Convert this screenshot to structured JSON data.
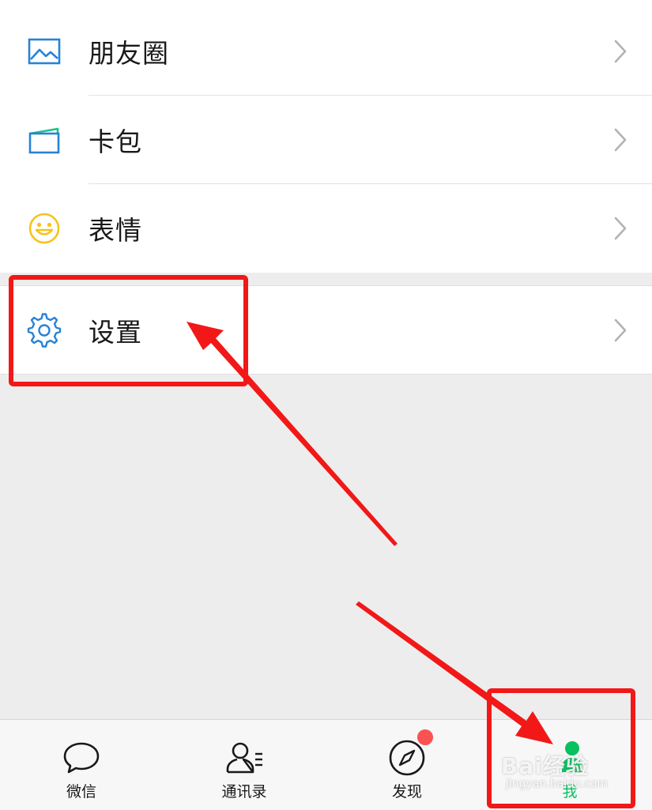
{
  "menu_group_1": [
    {
      "label": "朋友圈",
      "icon": "moments-image-icon"
    },
    {
      "label": "卡包",
      "icon": "card-wallet-icon"
    },
    {
      "label": "表情",
      "icon": "smiley-face-icon"
    }
  ],
  "menu_group_2": [
    {
      "label": "设置",
      "icon": "gear-icon"
    }
  ],
  "tabbar": {
    "tabs": [
      {
        "label": "微信",
        "icon": "chat-bubble-icon",
        "active": false
      },
      {
        "label": "通讯录",
        "icon": "contacts-icon",
        "active": false
      },
      {
        "label": "发现",
        "icon": "compass-icon",
        "active": false,
        "badge": "red-dot"
      },
      {
        "label": "我",
        "icon": "me-person-icon",
        "active": true
      }
    ]
  },
  "watermark": {
    "text": "Bai经验",
    "sub": "jingyan.baidu.com"
  },
  "colors": {
    "background": "#ededed",
    "card": "#ffffff",
    "accent_green": "#07c160",
    "icon_blue": "#2782d7",
    "emoji_yellow": "#f8c21a",
    "badge_red": "#fa5151",
    "annotation_red": "#f21818"
  }
}
